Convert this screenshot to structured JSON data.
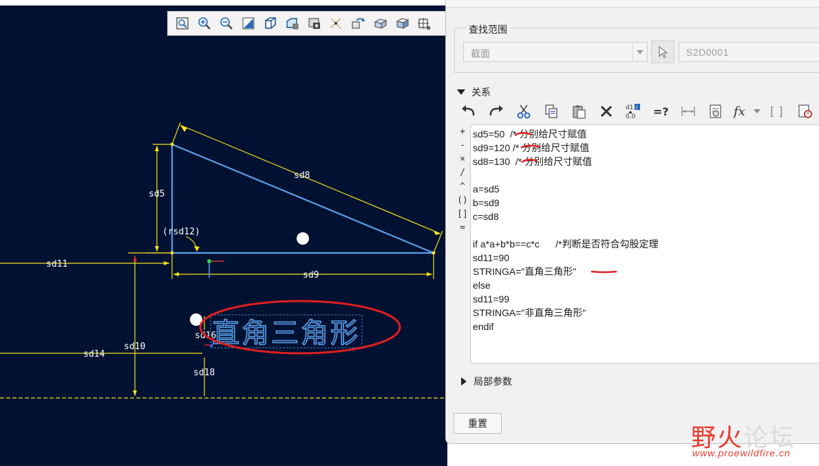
{
  "colors": {
    "canvas_bg": "#001131",
    "sketch_line": "#5aa0e6",
    "dimension": "#f5e21a",
    "annotation_red": "#e02020",
    "panel_bg": "#f1f1f1",
    "watermark_red": "#e83a2e"
  },
  "toolbar": {
    "icons": [
      "refit-icon",
      "zoom-in-icon",
      "zoom-out-icon",
      "repaint-icon",
      "display-style-icon",
      "saved-orientations-icon",
      "view-manager-icon",
      "datum-display-icon",
      "annotation-display-icon",
      "perspective-icon",
      "shading-icon",
      "spin-center-icon"
    ]
  },
  "sketch": {
    "dimension_labels": [
      "sd8",
      "sd5",
      "(rsd12)",
      "sd11",
      "sd9",
      "sd10",
      "sd14",
      "sd16",
      "sd18"
    ],
    "text_entity": "直角三角形"
  },
  "panel": {
    "scope": {
      "title": "查找范围",
      "type_value": "截面",
      "feature_value": "S2D0001"
    },
    "relations": {
      "title": "关系",
      "toolbar": [
        "undo-icon",
        "redo-icon",
        "cut-icon",
        "copy-icon",
        "paste-icon",
        "delete-icon",
        "toggle-names-icon",
        "evaluate-icon",
        "show-dimension-icon",
        "sort-relations-icon",
        "function-icon",
        "parameters-icon",
        "units-icon"
      ],
      "side_operators": [
        "+",
        "-",
        "×",
        "/",
        "^",
        "()",
        "[]",
        "="
      ],
      "code_lines": [
        "sd5=50  /* 分别给尺寸赋值",
        "sd9=120 /* 分别给尺寸赋值",
        "sd8=130  /* 分别给尺寸赋值",
        "",
        "a=sd5",
        "b=sd9",
        "c=sd8",
        "",
        "if a*a+b*b==c*c      /*判断是否符合勾股定理",
        "sd11=90",
        "STRINGA=\"直角三角形\"",
        "else",
        "sd11=99",
        "STRINGA=\"非直角三角形\"",
        "endif"
      ]
    },
    "local_params": {
      "title": "局部参数"
    },
    "reset_label": "重置"
  },
  "watermark": {
    "title_a": "野",
    "title_b": "火",
    "title_c": "论坛",
    "url": "www.proewildfire.cn"
  }
}
